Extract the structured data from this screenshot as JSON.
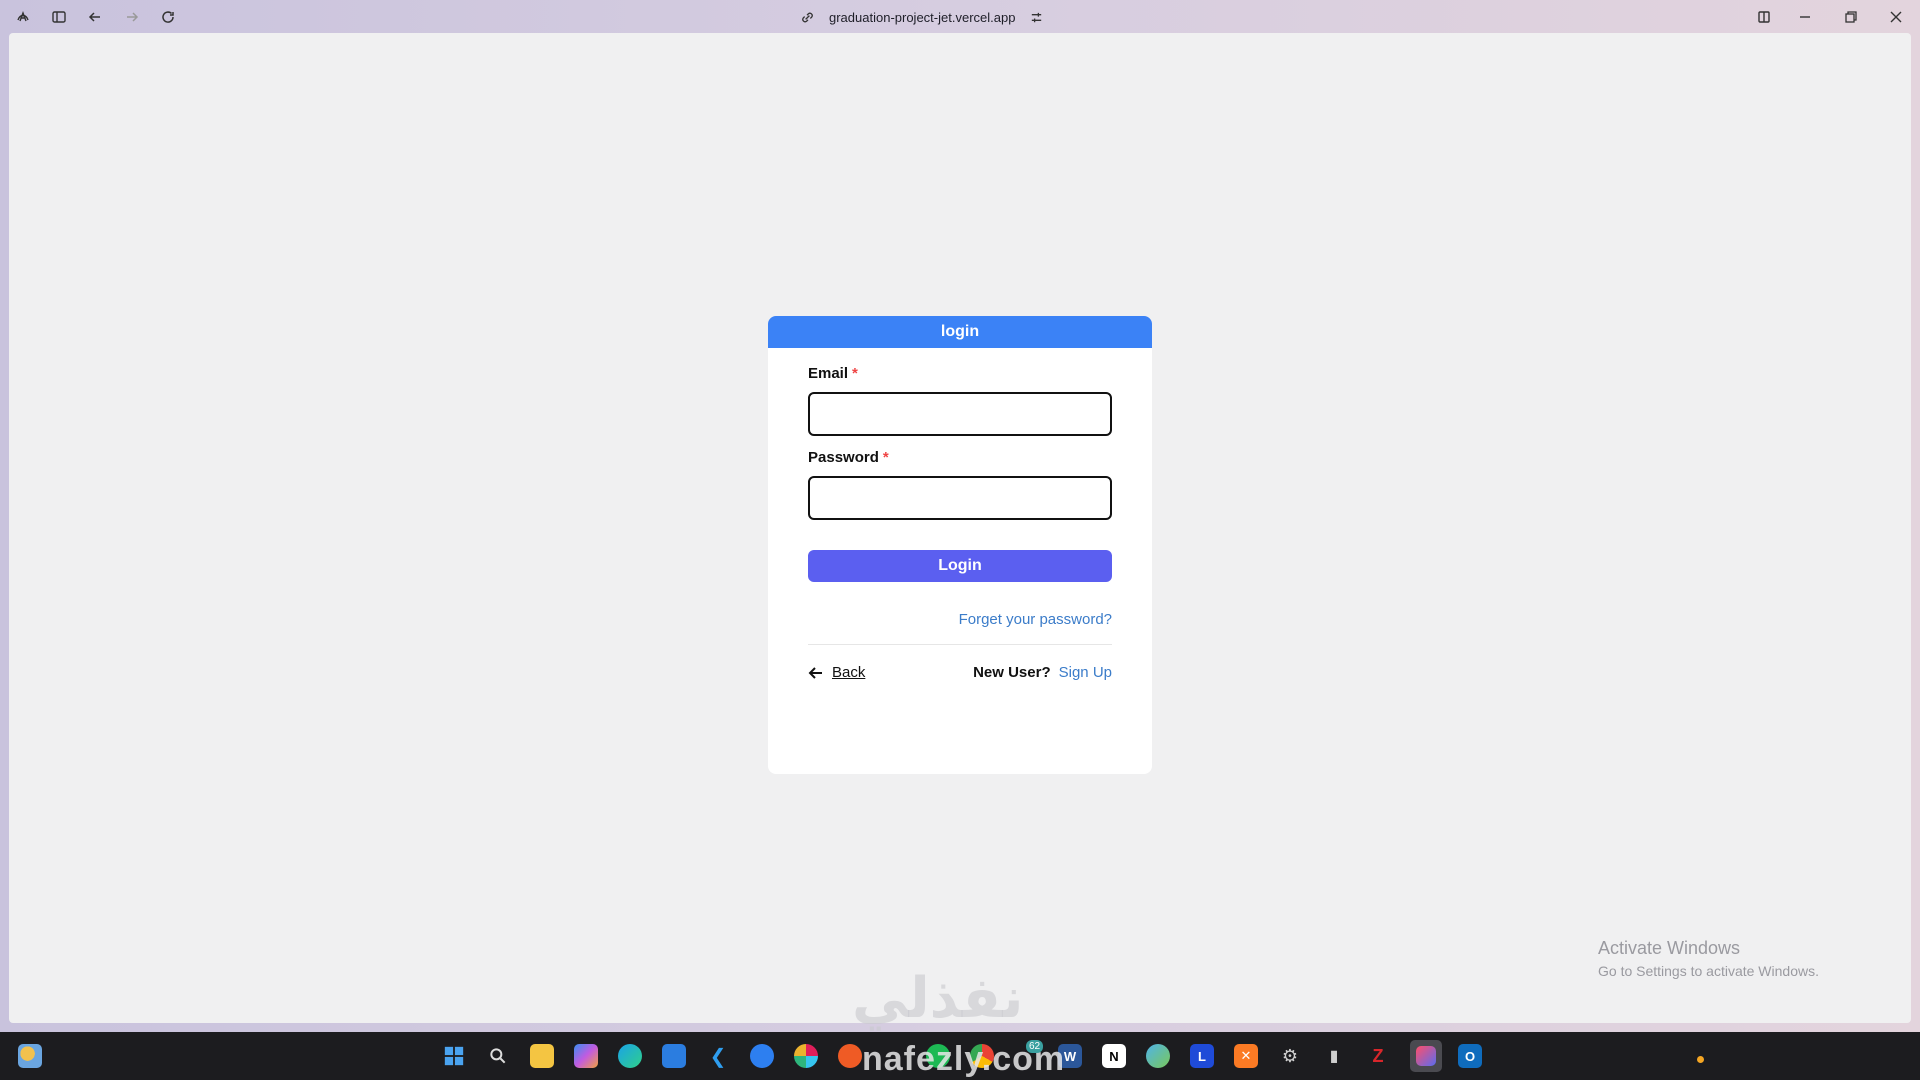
{
  "browser": {
    "url": "graduation-project-jet.vercel.app"
  },
  "card": {
    "header": "login",
    "email_label": "Email",
    "password_label": "Password",
    "required_mark": "*",
    "email_value": "",
    "password_value": "",
    "login_button": "Login",
    "forgot_link": "Forget your password?",
    "back_link": "Back",
    "new_user_text": "New User?",
    "signup_link": "Sign Up"
  },
  "overlay": {
    "activate_title": "Activate Windows",
    "activate_sub": "Go to Settings to activate Windows.",
    "watermark_ar": "نفذلي",
    "watermark_en": "nafezly.com"
  },
  "taskbar": {
    "badge_count": "62",
    "icons": [
      "weather-icon",
      "start-icon",
      "search-icon",
      "file-explorer-icon",
      "copilot-icon",
      "edge-icon",
      "store-icon",
      "vscode-icon",
      "app-icon",
      "slack-icon",
      "postman-icon",
      "spotify-icon",
      "chrome-icon",
      "word-icon",
      "notion-icon",
      "globe-icon",
      "l-app-icon",
      "xampp-icon",
      "settings-icon",
      "device-icon",
      "filezilla-icon",
      "arc-browser-icon",
      "outlook-icon"
    ]
  },
  "colors": {
    "header_blue": "#3b82f6",
    "button_indigo": "#5b5ff0",
    "link_blue": "#3b7cc9",
    "required_red": "#ef4444"
  }
}
